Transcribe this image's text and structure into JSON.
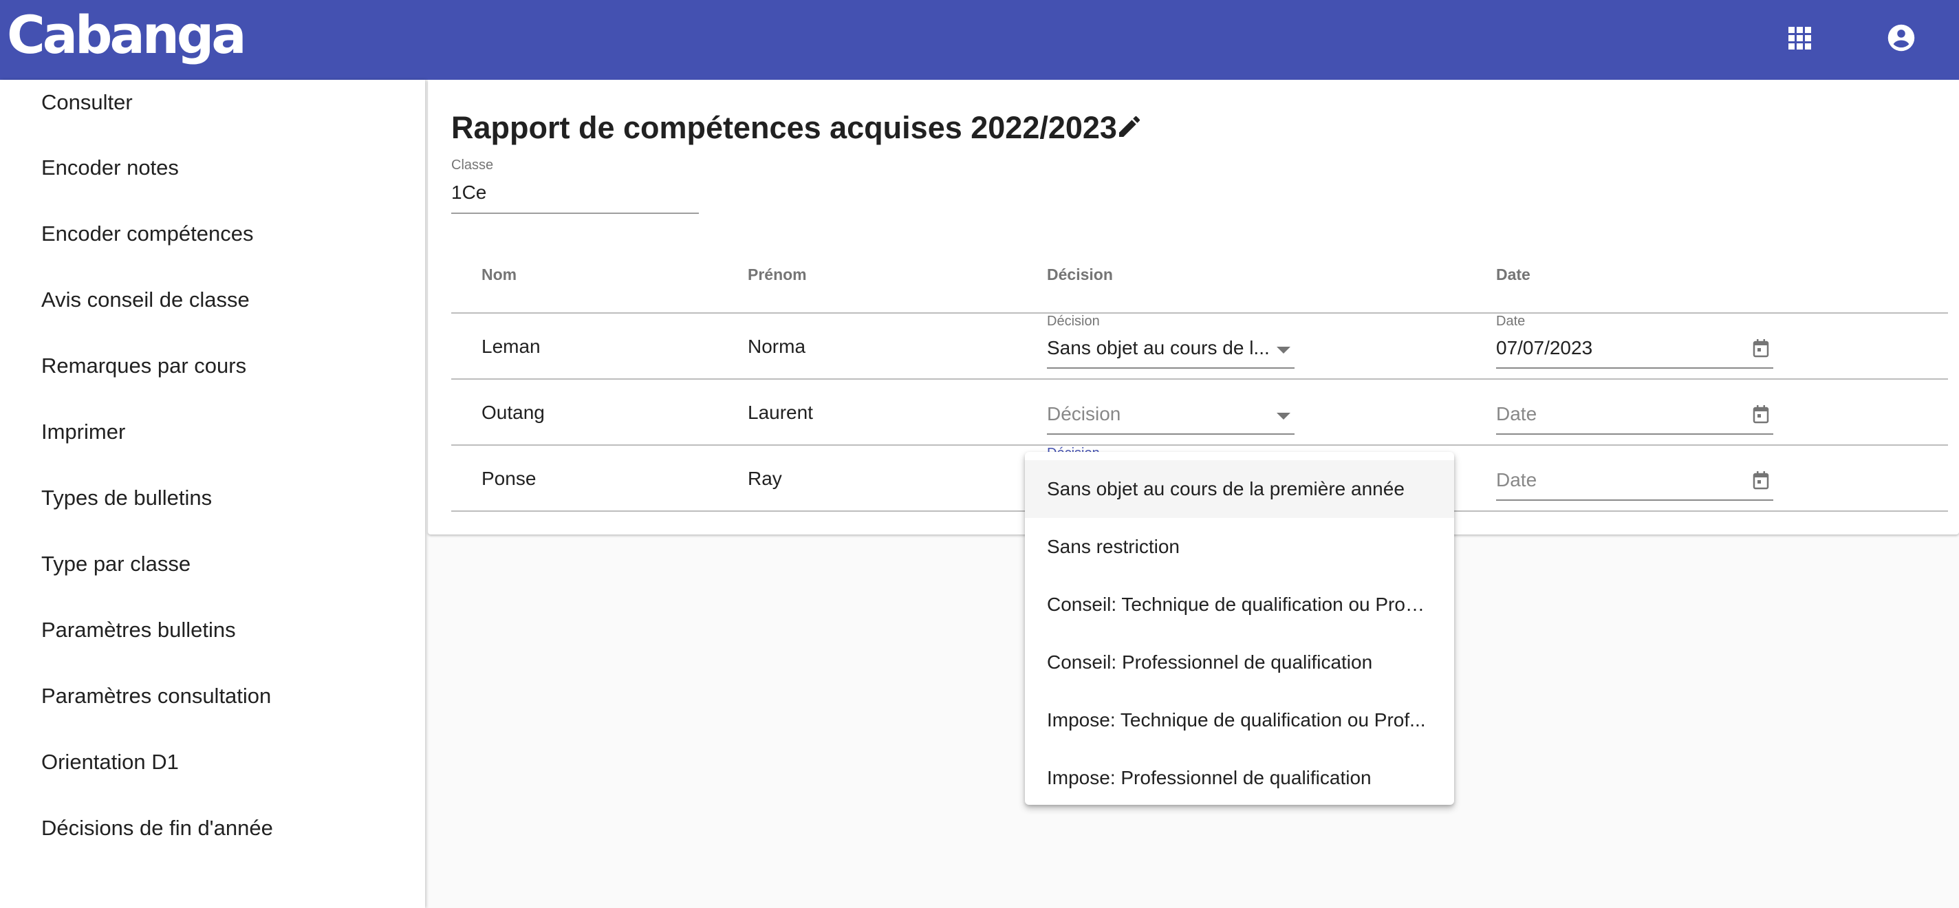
{
  "app": {
    "logo": "Cabanga",
    "header_icons": [
      "apps-grid-icon",
      "account-circle-icon"
    ],
    "brand_color": "#4451b1"
  },
  "sidebar": {
    "items": [
      {
        "label": "Consulter"
      },
      {
        "label": "Encoder notes"
      },
      {
        "label": "Encoder compétences"
      },
      {
        "label": "Avis conseil de classe"
      },
      {
        "label": "Remarques par cours"
      },
      {
        "label": "Imprimer"
      },
      {
        "label": "Types de bulletins"
      },
      {
        "label": "Type par classe"
      },
      {
        "label": "Paramètres bulletins"
      },
      {
        "label": "Paramètres consultation"
      },
      {
        "label": "Orientation D1"
      },
      {
        "label": "Décisions de fin d'année"
      }
    ]
  },
  "main": {
    "title": "Rapport de compétences acquises 2022/2023",
    "edit_icon": "pencil-icon",
    "classe": {
      "label": "Classe",
      "value": "1Ce"
    },
    "table": {
      "columns": [
        "Nom",
        "Prénom",
        "Décision",
        "Date"
      ],
      "rows": [
        {
          "nom": "Leman",
          "prenom": "Norma",
          "decision_label": "Décision",
          "decision": "Sans objet au cours de l...",
          "date_label": "Date",
          "date": "07/07/2023"
        },
        {
          "nom": "Outang",
          "prenom": "Laurent",
          "decision_placeholder": "Décision",
          "date_placeholder": "Date"
        },
        {
          "nom": "Ponse",
          "prenom": "Ray",
          "decision_label": "Décision",
          "date_placeholder": "Date"
        }
      ]
    }
  },
  "dropdown": {
    "options": [
      "Sans objet au cours de la première année",
      "Sans restriction",
      "Conseil: Technique de qualification ou Prof...",
      "Conseil: Professionnel de qualification",
      "Impose: Technique de qualification ou Prof...",
      "Impose: Professionnel de qualification"
    ],
    "highlighted_index": 0
  }
}
